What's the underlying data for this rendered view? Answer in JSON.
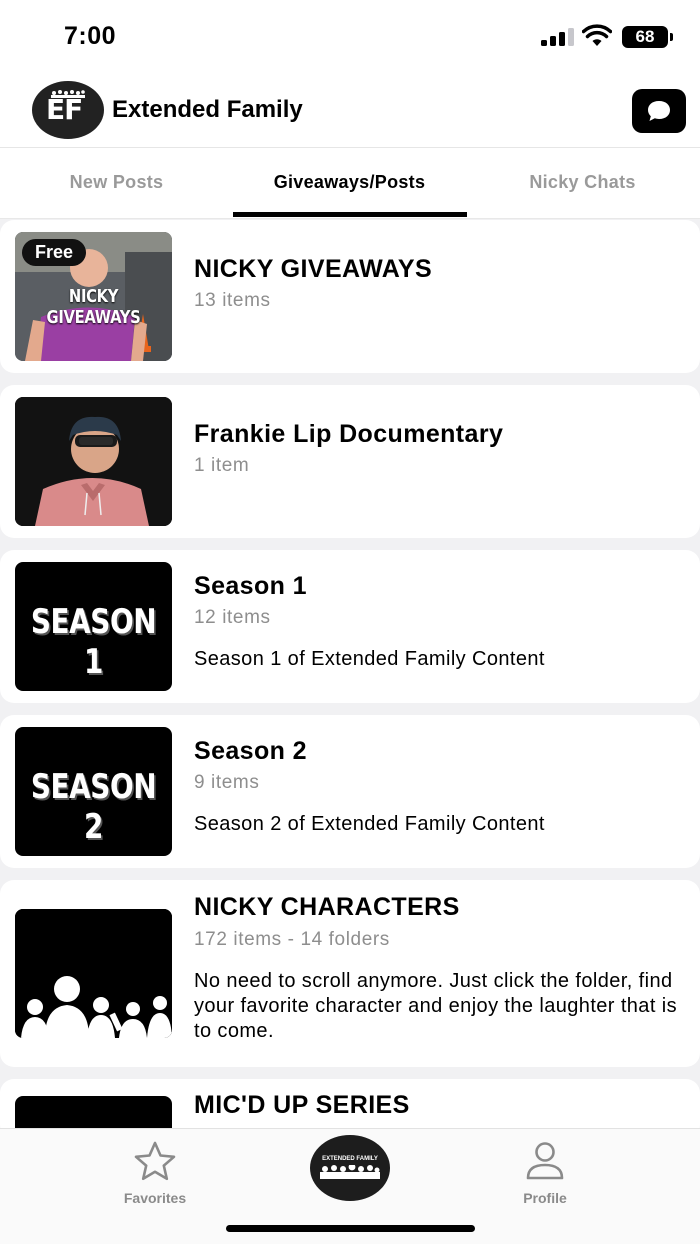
{
  "status_bar": {
    "time": "7:00",
    "battery": "68"
  },
  "header": {
    "logo_text": "EF",
    "title": "Extended Family"
  },
  "tabs": [
    {
      "label": "New Posts",
      "active": false
    },
    {
      "label": "Giveaways/Posts",
      "active": true
    },
    {
      "label": "Nicky Chats",
      "active": false
    }
  ],
  "cards": [
    {
      "title": "NICKY GIVEAWAYS",
      "count": "13 items",
      "badge": "Free",
      "thumb_text": "NICKY GIVEAWAYS"
    },
    {
      "title": "Frankie Lip Documentary",
      "count": "1 item"
    },
    {
      "title": "Season 1",
      "count": "12 items",
      "description": "Season 1 of Extended Family Content",
      "thumb_text": "SEASON 1"
    },
    {
      "title": "Season 2",
      "count": "9 items",
      "description": "Season 2 of Extended Family Content",
      "thumb_text": "SEASON 2"
    },
    {
      "title": "NICKY CHARACTERS",
      "count": "172 items - 14 folders",
      "description": "No need to scroll anymore. Just click the folder, find your favorite character and enjoy the laughter that is to come."
    },
    {
      "title": "MIC'D UP SERIES"
    }
  ],
  "bottom_nav": {
    "favorites": "Favorites",
    "profile": "Profile",
    "center_logo_text": "EXTENDED FAMILY"
  },
  "colors": {
    "accent": "#000000",
    "muted": "#8e8e8e",
    "background": "#f1f1f3"
  }
}
